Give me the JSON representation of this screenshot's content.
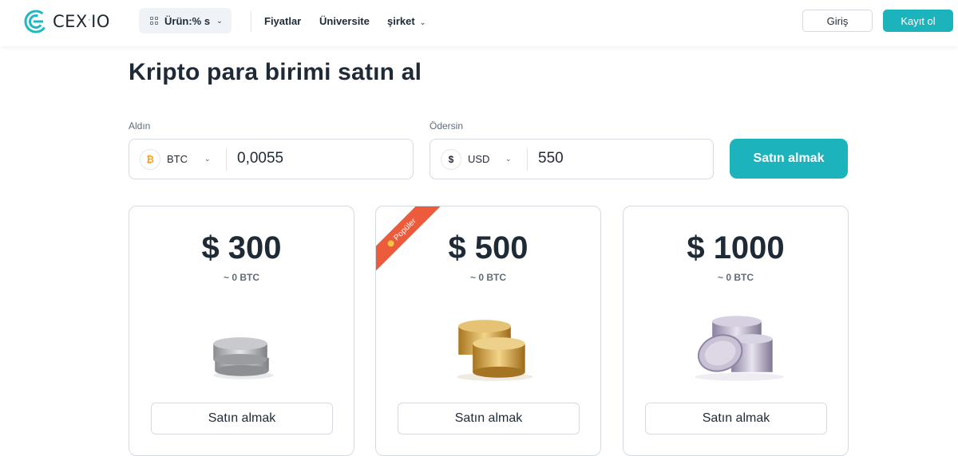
{
  "header": {
    "logo_text": "CEX",
    "logo_suffix": "IO",
    "product_label": "Ürün:% s",
    "nav": [
      "Fiyatlar",
      "Üniversite",
      "şirket"
    ],
    "login_label": "Giriş",
    "signup_label": "Kayıt ol"
  },
  "page": {
    "title": "Kripto para birimi satın al"
  },
  "exchange": {
    "receive_label": "Aldın",
    "receive_currency": "BTC",
    "receive_symbol": "₿",
    "receive_value": "0,0055",
    "pay_label": "Ödersin",
    "pay_currency": "USD",
    "pay_symbol": "$",
    "pay_value": "550",
    "buy_label": "Satın almak"
  },
  "cards": [
    {
      "amount": "$ 300",
      "btc": "~ 0 BTC",
      "button": "Satın almak",
      "coin": "silver-coins-icon"
    },
    {
      "amount": "$ 500",
      "btc": "~ 0 BTC",
      "button": "Satın almak",
      "coin": "gold-coins-icon",
      "badge": "Popüler"
    },
    {
      "amount": "$ 1000",
      "btc": "~ 0 BTC",
      "button": "Satın almak",
      "coin": "platinum-coins-icon"
    }
  ],
  "colors": {
    "accent": "#1db3bd",
    "badge": "#ec5b3c",
    "text": "#1f2a37"
  }
}
